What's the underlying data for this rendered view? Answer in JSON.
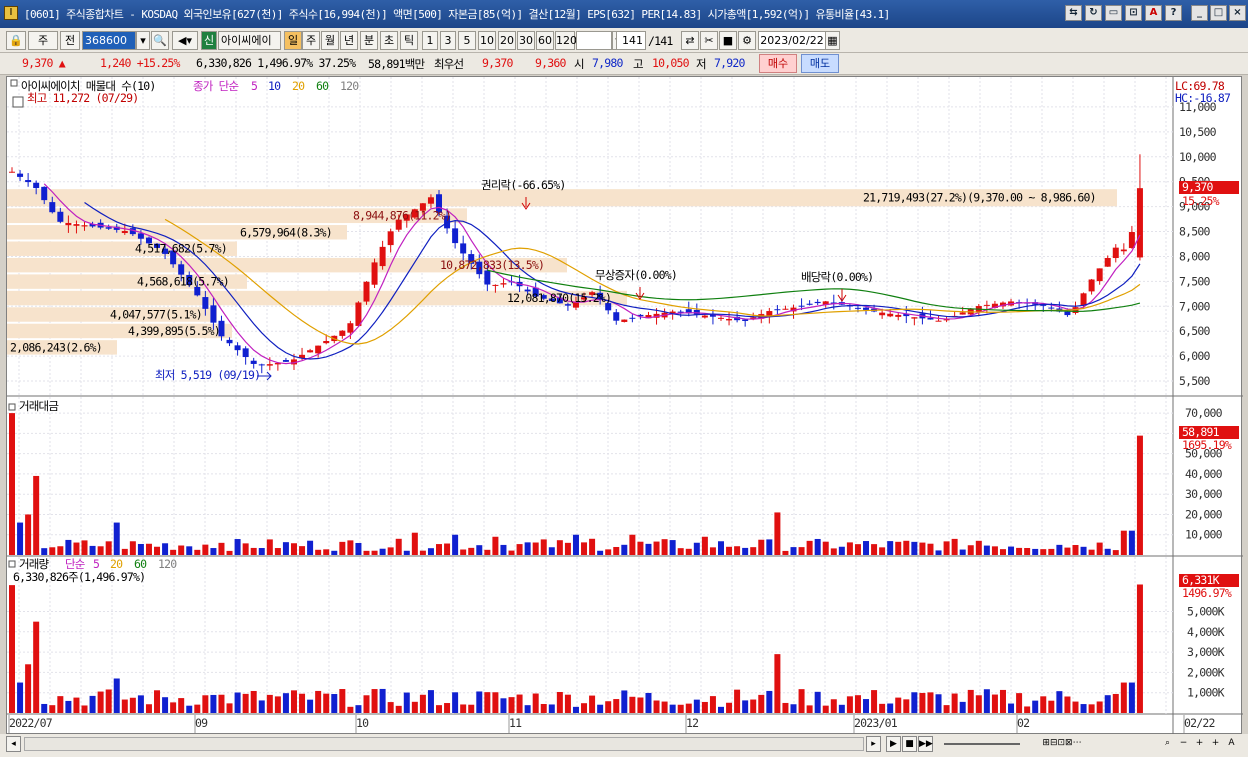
{
  "window": {
    "title": "[0601] 주식종합차트 - KOSDAQ 외국인보유[627(천)] 주식수[16,994(천)] 액면[500] 자본금[85(억)] 결산[12월] EPS[632] PER[14.83] 시가총액[1,592(억)] 유통비율[43.1]"
  },
  "toolbar": {
    "market": "주",
    "prev": "전",
    "code": "368600",
    "name": "아이씨에이",
    "periods": [
      "일",
      "주",
      "월",
      "년",
      "분",
      "초",
      "틱"
    ],
    "nums": [
      "1",
      "3",
      "5",
      "10",
      "20",
      "30",
      "60",
      "120"
    ],
    "count": "141",
    "total": "/141",
    "date": "2023/02/22",
    "sin": "신"
  },
  "quote": {
    "price": "9,370 ▲",
    "change": "1,240 +15.25%",
    "volume": "6,330,826 1,496.97% 37.25%",
    "amount": "58,891백만",
    "bid_label": "최우선",
    "bid1": "9,370",
    "bid2": "9,360",
    "open_label": "시",
    "open": "7,980",
    "high_label": "고",
    "high": "10,050",
    "low_label": "저",
    "low": "7,920",
    "buy": "매수",
    "sell": "매도"
  },
  "price_panel": {
    "legend_name": "아이씨에이치 매물대 수(10)",
    "legend_ma": "종가 단순",
    "ma": [
      "5",
      "10",
      "20",
      "60",
      "120"
    ],
    "max_label": "최고 11,272 (07/29)",
    "min_label": "최저 5,519 (09/19)",
    "lc": "LC:69.78",
    "hc": "HC:-16.87",
    "last_price": "9,370",
    "last_pct": "15.25%",
    "y_ticks": [
      "11,000",
      "10,500",
      "10,000",
      "9,500",
      "9,000",
      "8,500",
      "8,000",
      "7,500",
      "7,000",
      "6,500",
      "6,000",
      "5,500"
    ],
    "profiles": [
      "21,719,493(27.2%)(9,370.00 ~ 8,986.60)",
      "8,944,876(11.2%)",
      "6,579,964(8.3%)",
      "4,517,682(5.7%)",
      "10,872,833(13.5%)",
      "4,568,618(5.7%)",
      "12,081,870(15.2%)",
      "4,047,577(5.1%)",
      "4,399,895(5.5%)",
      "2,086,243(2.6%)"
    ],
    "events": [
      "권리락(-66.65%)",
      "무상증자(0.00%)",
      "배당락(0.00%)"
    ]
  },
  "amount_panel": {
    "title": "거래대금",
    "last": "58,891",
    "last_pct": "1695.19%",
    "y_ticks": [
      "70,000",
      "60,000",
      "50,000",
      "40,000",
      "30,000",
      "20,000",
      "10,000"
    ]
  },
  "volume_panel": {
    "title": "거래량",
    "legend_ma": "단순",
    "ma": [
      "5",
      "20",
      "60",
      "120"
    ],
    "info": "6,330,826주(1,496.97%)",
    "last": "6,331K",
    "last_pct": "1496.97%",
    "y_ticks": [
      "5,000K",
      "4,000K",
      "3,000K",
      "2,000K",
      "1,000K"
    ]
  },
  "x_axis": [
    "2022/07",
    "09",
    "10",
    "11",
    "12",
    "2023/01",
    "02",
    "02/22"
  ],
  "colors": {
    "up": "#e01010",
    "down": "#1020d0",
    "band": "#f7e3cc"
  },
  "chart_data": {
    "type": "candlestick",
    "candle_count": 141,
    "last": {
      "open": 7980,
      "high": 10050,
      "low": 7920,
      "close": 9370
    },
    "high_point": {
      "value": 11272,
      "date": "07/29"
    },
    "low_point": {
      "value": 5519,
      "date": "09/19"
    },
    "y_range": [
      5300,
      11400
    ]
  }
}
